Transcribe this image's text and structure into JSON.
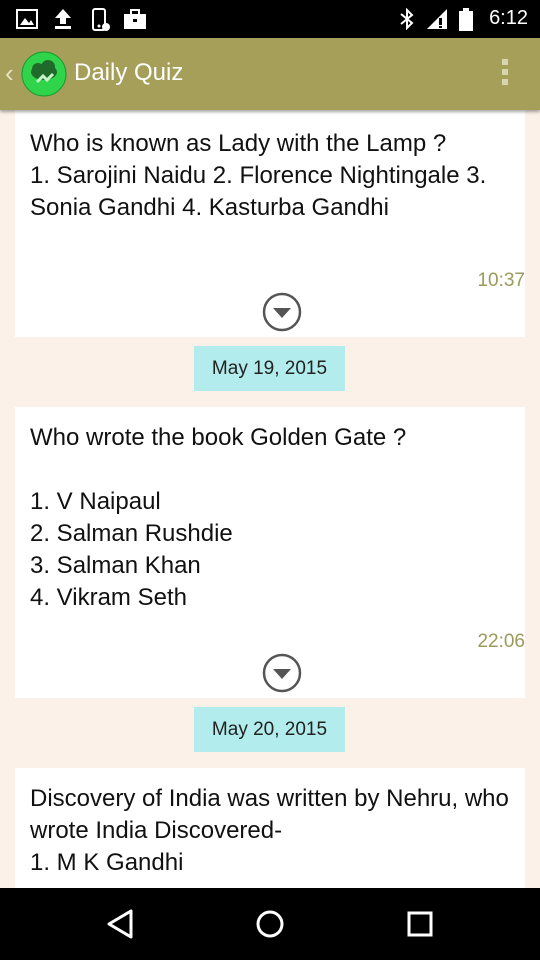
{
  "status_bar": {
    "time": "6:12",
    "icons": [
      "gallery-notification-icon",
      "upload-notification-icon",
      "phone-notification-icon",
      "briefcase-notification-icon",
      "bluetooth-icon",
      "signal-icon",
      "battery-icon"
    ]
  },
  "app_bar": {
    "title": "Daily Quiz",
    "logo_icon": "daily-quiz-logo-icon",
    "colors": {
      "bar": "#a59f5a",
      "logo_circle": "#2fd44a"
    }
  },
  "messages": [
    {
      "text": "Who is known as Lady with the Lamp ?\n1. Sarojini Naidu 2. Florence Nightingale 3. Sonia Gandhi 4. Kasturba Gandhi",
      "time": "10:37"
    },
    {
      "date": "May 19, 2015",
      "text": "Who wrote the book Golden Gate ?\n\n1. V Naipaul\n2. Salman Rushdie\n3. Salman Khan\n4. Vikram Seth",
      "time": "22:06"
    },
    {
      "date": "May 20, 2015",
      "text": "Discovery of India was written by Nehru, who wrote India Discovered-\n1. M K Gandhi"
    }
  ],
  "colors": {
    "background": "#fbf1e8",
    "date_chip": "#b2ecec",
    "time_text": "#9a9a5c"
  },
  "nav_bar": {
    "icons": [
      "back-triangle-icon",
      "home-circle-icon",
      "recents-square-icon"
    ]
  }
}
